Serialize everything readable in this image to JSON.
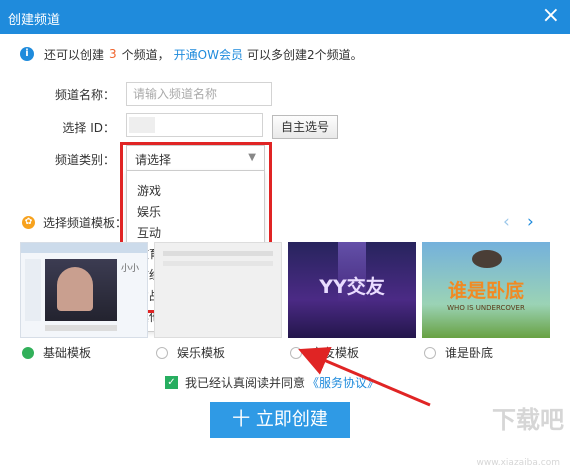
{
  "window": {
    "title": "创建频道",
    "close_glyph": "×"
  },
  "notice": {
    "prefix": "还可以创建",
    "count": "3",
    "middle": "个频道，",
    "link": "开通OW会员",
    "suffix": "可以多创建2个频道。"
  },
  "form": {
    "name_label": "频道名称：",
    "name_placeholder": "请输入频道名称",
    "id_label": "选择 ID：",
    "self_select_button": "自主选号",
    "category_label": "频道类别：",
    "category_value": "请选择",
    "category_options": [
      "游戏",
      "娱乐",
      "互动",
      "教育",
      "财经",
      "约战",
      "其他"
    ]
  },
  "templates": {
    "title": "选择频道模板：",
    "items": [
      {
        "label": "基础模板",
        "selected": true
      },
      {
        "label": "娱乐模板",
        "selected": false
      },
      {
        "label": "交友模板",
        "selected": false,
        "art": "YY交友"
      },
      {
        "label": "谁是卧底",
        "selected": false,
        "art": "谁是卧底",
        "art_sub": "WHO IS UNDERCOVER"
      }
    ],
    "thumb1_caption": "小小"
  },
  "agreement": {
    "text": "我已经认真阅读并同意",
    "link": "《服务协议》"
  },
  "create_button": "十 立即创建",
  "watermark": {
    "main": "下载吧",
    "sub": "www.xiazaiba.com"
  },
  "colors": {
    "titlebar": "#1f8bdc",
    "accent": "#2f9ae5",
    "highlight_box": "#e02424",
    "count": "#f0642d",
    "selected_radio": "#32b05a"
  }
}
